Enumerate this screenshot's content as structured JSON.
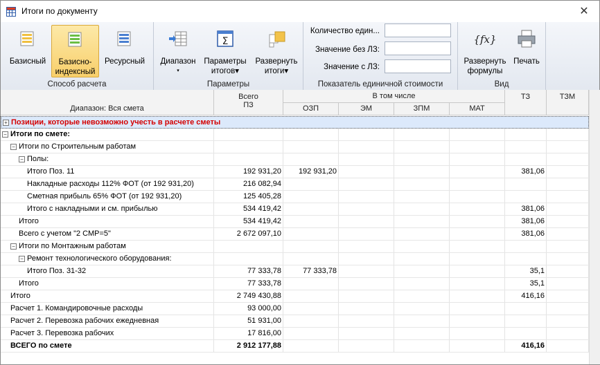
{
  "window": {
    "title": "Итоги по документу",
    "close_glyph": "✕"
  },
  "ribbon": {
    "calc_group": {
      "caption": "Способ расчета",
      "buttons": [
        {
          "label1": "Базисный",
          "label2": ""
        },
        {
          "label1": "Базисно-",
          "label2": "индексный"
        },
        {
          "label1": "Ресурсный",
          "label2": ""
        }
      ]
    },
    "params_group": {
      "caption": "Параметры",
      "buttons": [
        {
          "label1": "Диапазон",
          "label2": "▾"
        },
        {
          "label1": "Параметры",
          "label2": "итогов▾"
        },
        {
          "label1": "Развернуть",
          "label2": "итоги▾"
        }
      ]
    },
    "unit_group": {
      "caption": "Показатель единичной стоимости",
      "fields": [
        {
          "label": "Количество един...",
          "value": ""
        },
        {
          "label": "Значение без ЛЗ:",
          "value": ""
        },
        {
          "label": "Значение с ЛЗ:",
          "value": ""
        }
      ]
    },
    "view_group": {
      "caption": "Вид",
      "buttons": [
        {
          "label1": "Развернуть",
          "label2": "формулы"
        },
        {
          "label1": "Печать",
          "label2": ""
        }
      ]
    }
  },
  "grid": {
    "headers": {
      "range": "Диапазон: Вся смета",
      "total1": "Всего",
      "total2": "ПЗ",
      "incl": "В том числе",
      "ozp": "ОЗП",
      "em": "ЭМ",
      "zpm": "ЗПМ",
      "mat": "МАТ",
      "tz": "ТЗ",
      "tzm": "ТЗМ"
    },
    "rows": [
      {
        "indent": 0,
        "exp": "+",
        "name": "Позиции, которые невозможно учесть в расчете сметы",
        "pz": "",
        "ozp": "",
        "tz": "",
        "style": "warn"
      },
      {
        "indent": 0,
        "exp": "−",
        "name": "Итоги по смете:",
        "pz": "",
        "ozp": "",
        "tz": "",
        "style": "bold"
      },
      {
        "indent": 1,
        "exp": "−",
        "name": "Итоги по Строительным работам",
        "pz": "",
        "ozp": "",
        "tz": "",
        "style": ""
      },
      {
        "indent": 2,
        "exp": "−",
        "name": "Полы:",
        "pz": "",
        "ozp": "",
        "tz": "",
        "style": ""
      },
      {
        "indent": 3,
        "exp": "",
        "name": "Итого Поз. 11",
        "pz": "192 931,20",
        "ozp": "192 931,20",
        "tz": "381,06",
        "style": ""
      },
      {
        "indent": 3,
        "exp": "",
        "name": "Накладные расходы 112% ФОТ (от 192 931,20)",
        "pz": "216 082,94",
        "ozp": "",
        "tz": "",
        "style": ""
      },
      {
        "indent": 3,
        "exp": "",
        "name": "Сметная прибыль 65% ФОТ (от 192 931,20)",
        "pz": "125 405,28",
        "ozp": "",
        "tz": "",
        "style": ""
      },
      {
        "indent": 3,
        "exp": "",
        "name": "Итого с накладными и см. прибылью",
        "pz": "534 419,42",
        "ozp": "",
        "tz": "381,06",
        "style": ""
      },
      {
        "indent": 2,
        "exp": "",
        "name": "Итого",
        "pz": "534 419,42",
        "ozp": "",
        "tz": "381,06",
        "style": ""
      },
      {
        "indent": 2,
        "exp": "",
        "name": "Всего с учетом \"2 СМР=5\"",
        "pz": "2 672 097,10",
        "ozp": "",
        "tz": "381,06",
        "style": ""
      },
      {
        "indent": 1,
        "exp": "−",
        "name": "Итоги по Монтажным работам",
        "pz": "",
        "ozp": "",
        "tz": "",
        "style": ""
      },
      {
        "indent": 2,
        "exp": "−",
        "name": "Ремонт технологического оборудования:",
        "pz": "",
        "ozp": "",
        "tz": "",
        "style": ""
      },
      {
        "indent": 3,
        "exp": "",
        "name": "Итого Поз. 31-32",
        "pz": "77 333,78",
        "ozp": "77 333,78",
        "tz": "35,1",
        "style": ""
      },
      {
        "indent": 2,
        "exp": "",
        "name": "Итого",
        "pz": "77 333,78",
        "ozp": "",
        "tz": "35,1",
        "style": ""
      },
      {
        "indent": 1,
        "exp": "",
        "name": "Итого",
        "pz": "2 749 430,88",
        "ozp": "",
        "tz": "416,16",
        "style": ""
      },
      {
        "indent": 1,
        "exp": "",
        "name": "Расчет 1.  Командировочные расходы",
        "pz": "93 000,00",
        "ozp": "",
        "tz": "",
        "style": ""
      },
      {
        "indent": 1,
        "exp": "",
        "name": "Расчет 2.  Перевозка рабочих ежедневная",
        "pz": "51 931,00",
        "ozp": "",
        "tz": "",
        "style": ""
      },
      {
        "indent": 1,
        "exp": "",
        "name": "Расчет 3.  Перевозка рабочих",
        "pz": "17 816,00",
        "ozp": "",
        "tz": "",
        "style": ""
      },
      {
        "indent": 1,
        "exp": "",
        "name": "ВСЕГО по смете",
        "pz": "2 912 177,88",
        "ozp": "",
        "tz": "416,16",
        "style": "bold"
      }
    ]
  }
}
